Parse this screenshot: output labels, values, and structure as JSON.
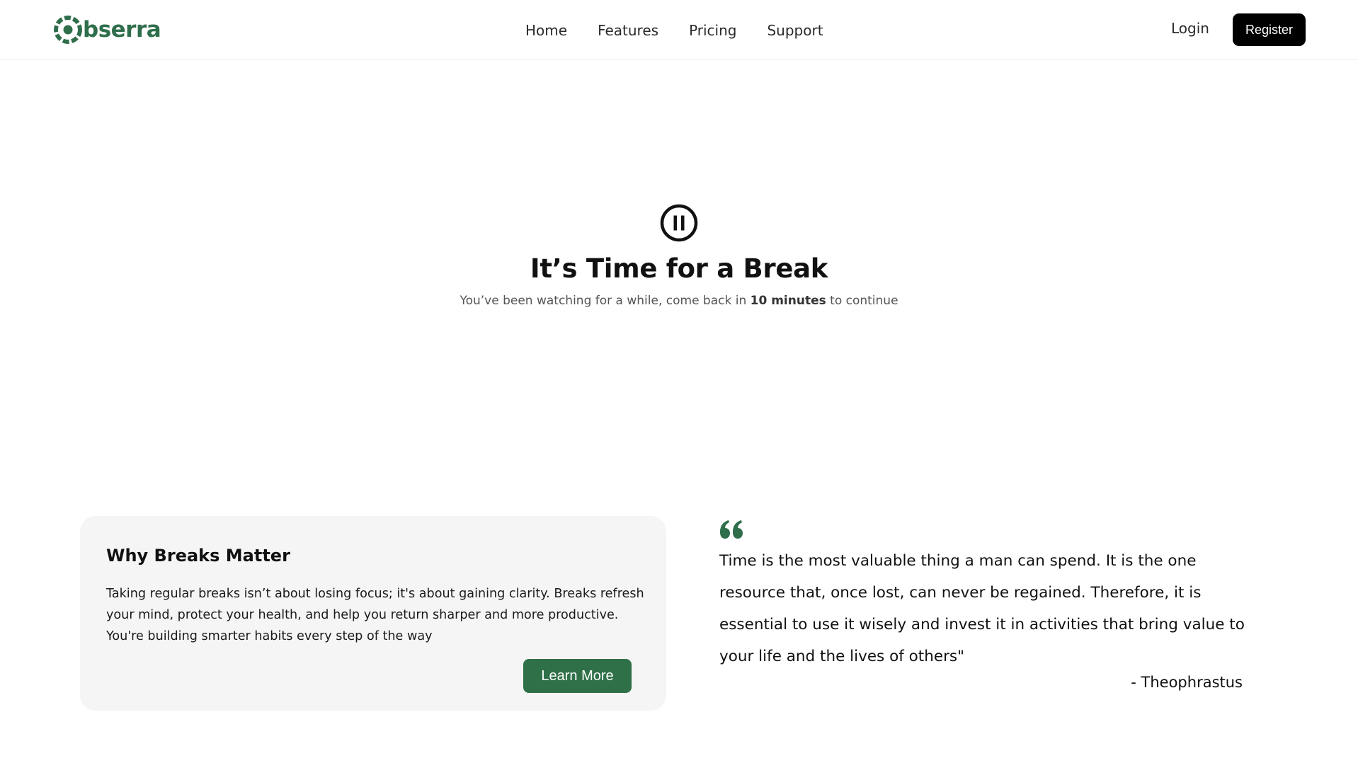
{
  "brand": {
    "name_suffix": "bserra",
    "logo_icon": "aperture-o-icon",
    "color": "#2f6e4b"
  },
  "nav": {
    "links": [
      "Home",
      "Features",
      "Pricing",
      "Support"
    ],
    "login_label": "Login",
    "register_label": "Register"
  },
  "hero": {
    "icon": "pause-circle-icon",
    "title": "It’s Time for a Break",
    "subtitle_before": "You’ve been watching for a while, come back in ",
    "subtitle_time": "10 minutes",
    "subtitle_after": " to continue"
  },
  "info_card": {
    "title": "Why Breaks Matter",
    "body": "Taking regular breaks isn’t about losing focus; it's about gaining clarity. Breaks refresh your mind, protect your health, and help you return sharper and more productive. You're building smarter habits every step of the way",
    "button_label": "Learn More",
    "button_color": "#2f7048"
  },
  "quote": {
    "icon": "quote-open-icon",
    "text": "Time is the most valuable thing a man can spend. It is the one resource that, once lost, can never be regained. Therefore, it is essential to use it wisely and invest it in activities that bring value to your life and the lives of others\"",
    "author": "- Theophrastus"
  }
}
